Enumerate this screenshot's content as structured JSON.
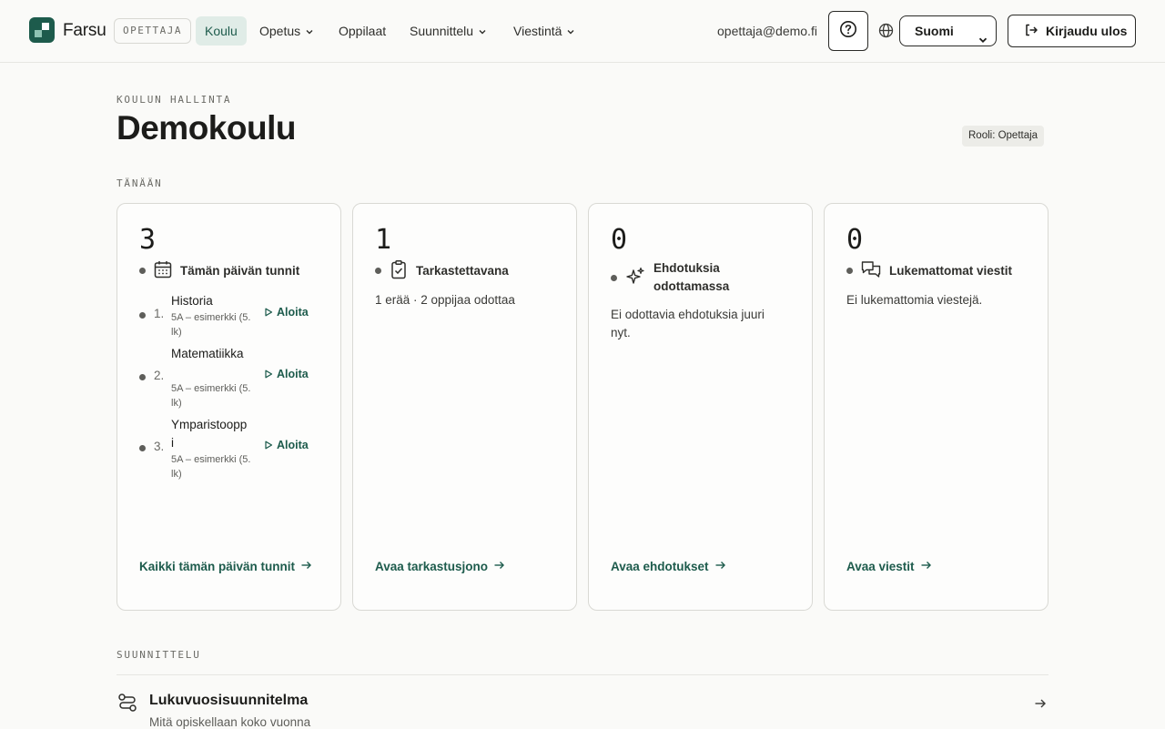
{
  "nav": {
    "brand": "Farsu",
    "role_pill": "OPETTAJA",
    "items": [
      {
        "label": "Koulu",
        "active": true,
        "dropdown": false
      },
      {
        "label": "Opetus",
        "active": false,
        "dropdown": true
      },
      {
        "label": "Oppilaat",
        "active": false,
        "dropdown": false
      },
      {
        "label": "Suunnittelu",
        "active": false,
        "dropdown": true
      },
      {
        "label": "Viestintä",
        "active": false,
        "dropdown": true
      }
    ],
    "email": "opettaja@demo.fi",
    "help_icon": "question-circle-icon",
    "language": "Suomi",
    "logout_label": "Kirjaudu ulos"
  },
  "header": {
    "eyebrow": "KOULUN HALLINTA",
    "title": "Demokoulu",
    "role_badge": "Rooli: Opettaja"
  },
  "today": {
    "label": "TÄNÄÄN",
    "cards": [
      {
        "count": "3",
        "icon": "calendar-icon",
        "title": "Tämän päivän tunnit",
        "lessons": [
          {
            "num": "1.",
            "name": "Historia",
            "meta": "5A – esimerkki (5. lk)",
            "action": "Aloita"
          },
          {
            "num": "2.",
            "name": "Matematiikka",
            "meta": "5A – esimerkki (5. lk)",
            "action": "Aloita"
          },
          {
            "num": "3.",
            "name": "Ymparistooppi",
            "meta": "5A – esimerkki (5. lk)",
            "action": "Aloita"
          }
        ],
        "link": "Kaikki tämän päivän tunnit"
      },
      {
        "count": "1",
        "icon": "clipboard-check-icon",
        "title": "Tarkastettavana",
        "text": "1 erää · 2 oppijaa odottaa",
        "link": "Avaa tarkastusjono"
      },
      {
        "count": "0",
        "icon": "sparkles-icon",
        "title": "Ehdotuksia odottamassa",
        "text": "Ei odottavia ehdotuksia juuri nyt.",
        "link": "Avaa ehdotukset"
      },
      {
        "count": "0",
        "icon": "chat-bubbles-icon",
        "title": "Lukemattomat viestit",
        "text": "Ei lukemattomia viestejä.",
        "link": "Avaa viestit"
      }
    ]
  },
  "planning": {
    "label": "SUUNNITTELU",
    "item_title": "Lukuvuosisuunnitelma",
    "item_subtitle": "Mitä opiskellaan koko vuonna"
  },
  "colors": {
    "accent": "#1d5b4c",
    "nav_active_bg": "#e0ece7",
    "page_bg": "#fafaf8"
  }
}
